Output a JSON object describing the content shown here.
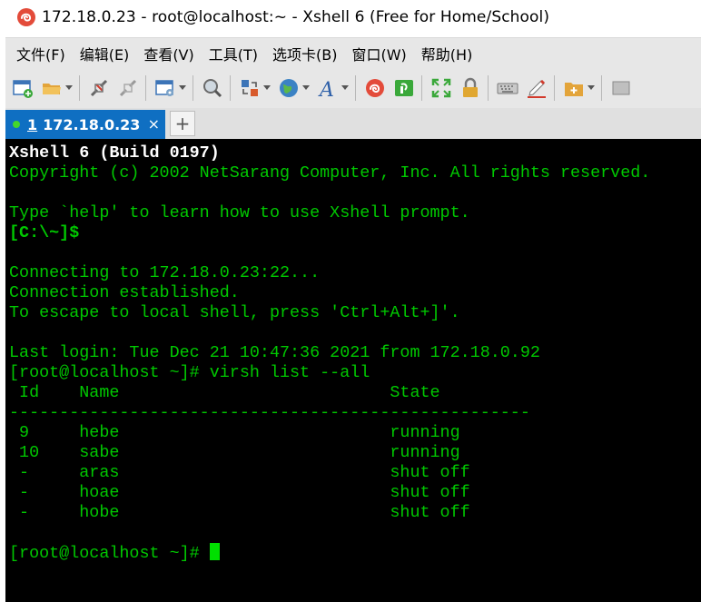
{
  "window": {
    "title": "172.18.0.23 - root@localhost:~ - Xshell 6 (Free for Home/School)"
  },
  "menu": [
    "文件(F)",
    "编辑(E)",
    "查看(V)",
    "工具(T)",
    "选项卡(B)",
    "窗口(W)",
    "帮助(H)"
  ],
  "toolbar": {
    "icons": [
      "new-session-icon",
      "open-folder-icon",
      "disconnect-icon",
      "reconnect-icon",
      "properties-icon",
      "find-icon",
      "transfer-icon",
      "globe-icon",
      "font-icon",
      "xshell-logo-icon",
      "xftp-icon",
      "fullscreen-icon",
      "lock-icon",
      "keyboard-icon",
      "highlight-icon",
      "new-folder-icon"
    ]
  },
  "tab": {
    "index": "1",
    "label": "172.18.0.23",
    "close": "×",
    "new_tab": "+"
  },
  "terminal": {
    "lines": [
      {
        "text": "Xshell 6 (Build 0197)",
        "style": "bright"
      },
      {
        "text": "Copyright (c) 2002 NetSarang Computer, Inc. All rights reserved.",
        "style": "normal"
      },
      {
        "text": "",
        "style": "normal"
      },
      {
        "text": "Type `help' to learn how to use Xshell prompt.",
        "style": "normal"
      },
      {
        "text": "[C:\\~]$",
        "style": "prompt"
      },
      {
        "text": "",
        "style": "normal"
      },
      {
        "text": "Connecting to 172.18.0.23:22...",
        "style": "normal"
      },
      {
        "text": "Connection established.",
        "style": "normal"
      },
      {
        "text": "To escape to local shell, press 'Ctrl+Alt+]'.",
        "style": "normal"
      },
      {
        "text": "",
        "style": "normal"
      },
      {
        "text": "Last login: Tue Dec 21 10:47:36 2021 from 172.18.0.92",
        "style": "normal"
      },
      {
        "text": "[root@localhost ~]# virsh list --all",
        "style": "normal"
      },
      {
        "text": " Id    Name                           State",
        "style": "normal"
      },
      {
        "text": "----------------------------------------------------",
        "style": "normal"
      },
      {
        "text": " 9     hebe                           running",
        "style": "normal"
      },
      {
        "text": " 10    sabe                           running",
        "style": "normal"
      },
      {
        "text": " -     aras                           shut off",
        "style": "normal"
      },
      {
        "text": " -     hoae                           shut off",
        "style": "normal"
      },
      {
        "text": " -     hobe                           shut off",
        "style": "normal"
      },
      {
        "text": "",
        "style": "normal"
      }
    ],
    "current_prompt": "[root@localhost ~]# "
  }
}
